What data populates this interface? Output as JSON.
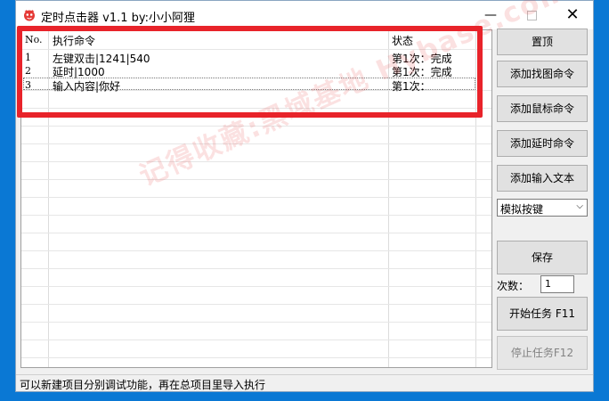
{
  "window": {
    "title": "定时点击器 v1.1 by:小小阿狸",
    "min_label": "—",
    "close_label": "✕"
  },
  "table": {
    "columns": [
      "No.",
      "执行命令",
      "状态"
    ],
    "rows": [
      {
        "no": "1",
        "command": "左键双击|1241|540",
        "status": "第1次：完成"
      },
      {
        "no": "2",
        "command": "延时|1000",
        "status": "第1次：完成"
      },
      {
        "no": "3",
        "command": "输入内容|你好",
        "status": "第1次："
      }
    ]
  },
  "buttons": {
    "pin": "置顶",
    "add_find_image": "添加找图命令",
    "add_mouse": "添加鼠标命令",
    "add_delay": "添加延时命令",
    "add_input_text": "添加输入文本",
    "save": "保存",
    "start": "开始任务 F11",
    "stop": "停止任务F12"
  },
  "select": {
    "value": "模拟按键",
    "arrow": "⌵"
  },
  "count": {
    "label": "次数：",
    "value": "1"
  },
  "statusbar": {
    "text": "可以新建项目分别调试功能，再在总项目里导入执行"
  },
  "watermark": {
    "text": "记得收藏:黑域基地 Hybase.com"
  },
  "colors": {
    "annotation": "#e8232a",
    "desktop": "#0a78d4"
  }
}
